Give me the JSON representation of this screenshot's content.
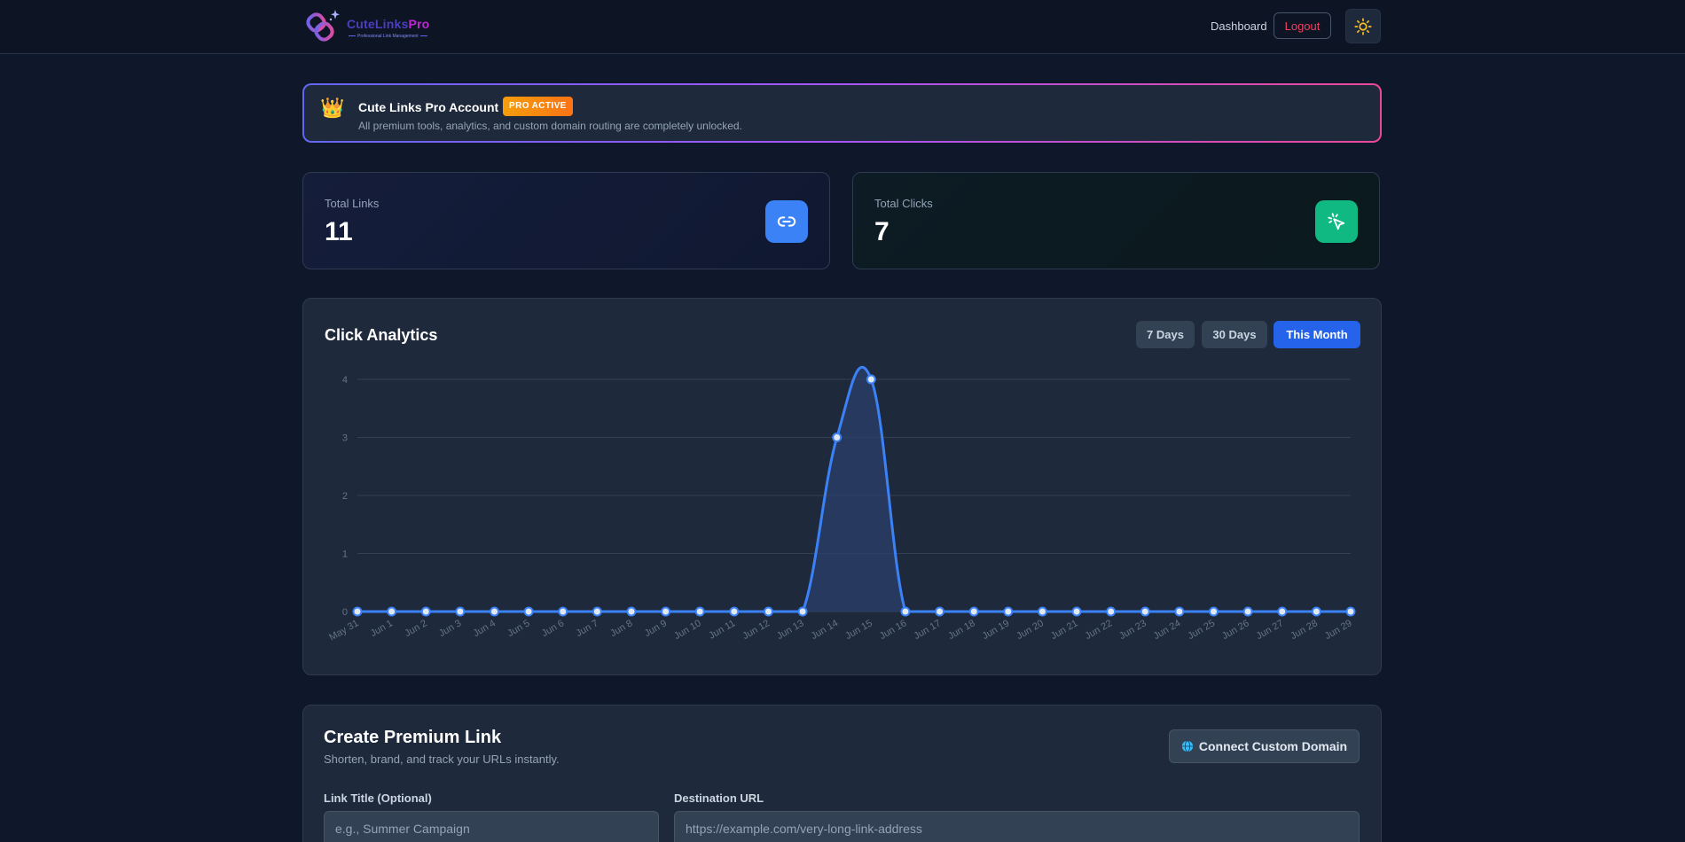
{
  "header": {
    "logo_name": "CuteLinks",
    "logo_pro": "Pro",
    "logo_tagline": "Professional Link Management",
    "nav_dashboard": "Dashboard",
    "logout_label": "Logout",
    "theme_icon": "sun-icon"
  },
  "banner": {
    "icon": "crown",
    "title": "Cute Links Pro Account",
    "badge": "PRO ACTIVE",
    "description": "All premium tools, analytics, and custom domain routing are completely unlocked."
  },
  "stats": {
    "links": {
      "label": "Total Links",
      "value": "11",
      "icon": "link-icon"
    },
    "clicks": {
      "label": "Total Clicks",
      "value": "7",
      "icon": "cursor-click-icon"
    }
  },
  "analytics": {
    "title": "Click Analytics",
    "ranges": [
      "7 Days",
      "30 Days",
      "This Month"
    ],
    "active_range": "This Month"
  },
  "chart_data": {
    "type": "area",
    "title": "",
    "xlabel": "",
    "ylabel": "",
    "ylim": [
      0,
      4
    ],
    "yticks": [
      0,
      1,
      2,
      3,
      4
    ],
    "grid": true,
    "x": [
      "May 31",
      "Jun 1",
      "Jun 2",
      "Jun 3",
      "Jun 4",
      "Jun 5",
      "Jun 6",
      "Jun 7",
      "Jun 8",
      "Jun 9",
      "Jun 10",
      "Jun 11",
      "Jun 12",
      "Jun 13",
      "Jun 14",
      "Jun 15",
      "Jun 16",
      "Jun 17",
      "Jun 18",
      "Jun 19",
      "Jun 20",
      "Jun 21",
      "Jun 22",
      "Jun 23",
      "Jun 24",
      "Jun 25",
      "Jun 26",
      "Jun 27",
      "Jun 28",
      "Jun 29"
    ],
    "series": [
      {
        "values": [
          0,
          0,
          0,
          0,
          0,
          0,
          0,
          0,
          0,
          0,
          0,
          0,
          0,
          0,
          3,
          4,
          0,
          0,
          0,
          0,
          0,
          0,
          0,
          0,
          0,
          0,
          0,
          0,
          0,
          0
        ]
      }
    ],
    "colors": {
      "line": "#3b82f6",
      "fill": "#2b3f6b",
      "grid": "#334155",
      "tick": "#64748b"
    }
  },
  "create": {
    "title": "Create Premium Link",
    "subtitle": "Shorten, brand, and track your URLs instantly.",
    "domain_button": "Connect Custom Domain",
    "domain_icon": "globe-icon",
    "title_label": "Link Title (Optional)",
    "title_placeholder": "e.g., Summer Campaign",
    "url_label": "Destination URL",
    "url_placeholder": "https://example.com/very-long-link-address"
  }
}
